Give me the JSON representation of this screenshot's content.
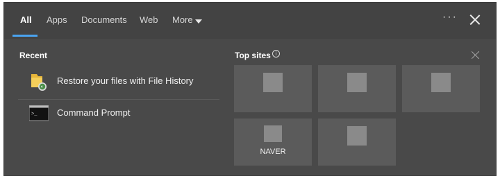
{
  "tabs": [
    {
      "label": "All"
    },
    {
      "label": "Apps"
    },
    {
      "label": "Documents"
    },
    {
      "label": "Web"
    },
    {
      "label": "More"
    }
  ],
  "header": {
    "ellipsis": "···"
  },
  "recent": {
    "title": "Recent",
    "items": [
      {
        "label": "Restore your files with File History",
        "icon": "file-history-icon"
      },
      {
        "label": "Command Prompt",
        "icon": "command-prompt-icon"
      }
    ]
  },
  "top_sites": {
    "title": "Top sites",
    "info": "i",
    "tiles": [
      {
        "name": ""
      },
      {
        "name": ""
      },
      {
        "name": ""
      },
      {
        "name": "NAVER"
      },
      {
        "name": ""
      }
    ]
  },
  "colors": {
    "accent": "#4aa3f0",
    "panel": "#494949",
    "tile": "#5b5b5b"
  }
}
